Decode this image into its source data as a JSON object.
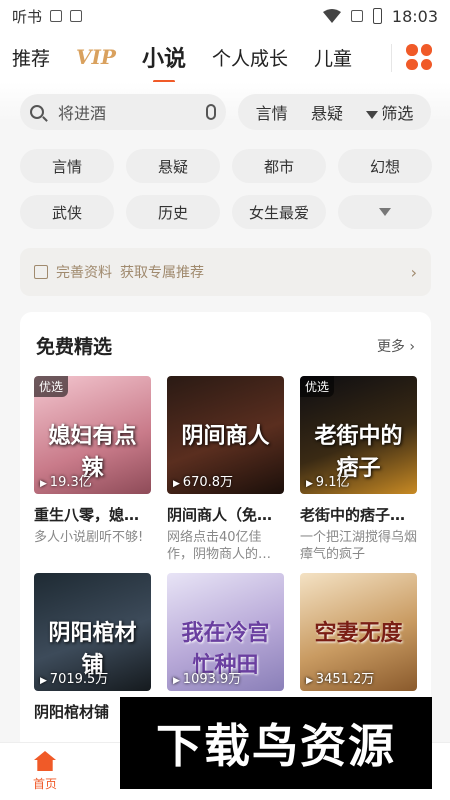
{
  "status_bar": {
    "carrier_text": "听书",
    "time": "18:03"
  },
  "top_tabs": [
    {
      "label": "推荐"
    },
    {
      "label": "VIP"
    },
    {
      "label": "小说"
    },
    {
      "label": "个人成长"
    },
    {
      "label": "儿童"
    }
  ],
  "search": {
    "placeholder": "将进酒"
  },
  "filters": {
    "item1": "言情",
    "item2": "悬疑",
    "filter_label": "筛选"
  },
  "genres": [
    "言情",
    "悬疑",
    "都市",
    "幻想",
    "武侠",
    "历史",
    "女生最爱"
  ],
  "banner": {
    "label": "完善资料",
    "text": "获取专属推荐"
  },
  "free_picks": {
    "title": "免费精选",
    "more": "更多",
    "books": [
      {
        "tag": "优选",
        "plays": "19.3亿",
        "cover_text": "媳妇有点辣",
        "name": "重生八零，媳…",
        "desc": "多人小说剧听不够!"
      },
      {
        "tag": "",
        "plays": "670.8万",
        "cover_text": "阴间商人",
        "name": "阴间商人（免…",
        "desc": "网络点击40亿佳作，阴物商人的…"
      },
      {
        "tag": "优选",
        "plays": "9.1亿",
        "cover_text": "老街中的痞子",
        "name": "老街中的痞子…",
        "desc": "一个把江湖搅得乌烟瘴气的疯子"
      },
      {
        "tag": "",
        "plays": "7019.5万",
        "cover_text": "阴阳棺材铺",
        "name": "阴阳棺材铺",
        "desc": ""
      },
      {
        "tag": "",
        "plays": "1093.9万",
        "cover_text": "我在冷宫忙种田",
        "name": "",
        "desc": ""
      },
      {
        "tag": "",
        "plays": "3451.2万",
        "cover_text": "空妻无度",
        "name": "",
        "desc": ""
      }
    ]
  },
  "bottom_nav": {
    "home": "首页"
  },
  "watermark": {
    "text": "下载鸟资源"
  },
  "colors": {
    "accent": "#f05a28",
    "vip": "#d9a15e",
    "banner_text": "#a08a6e"
  }
}
